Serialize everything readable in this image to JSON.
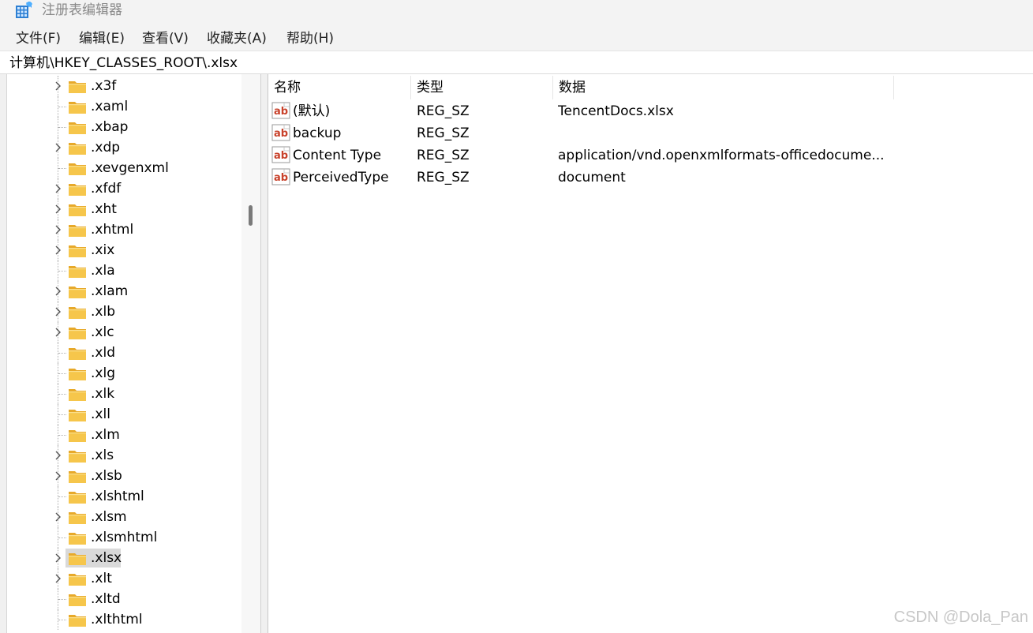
{
  "window": {
    "title": "注册表编辑器",
    "icon": "registry-editor-icon"
  },
  "menu": {
    "items": [
      "文件(F)",
      "编辑(E)",
      "查看(V)",
      "收藏夹(A)",
      "帮助(H)"
    ]
  },
  "address": {
    "path": "计算机\\HKEY_CLASSES_ROOT\\.xlsx"
  },
  "tree": {
    "items": [
      {
        "label": ".x3f",
        "expandable": true
      },
      {
        "label": ".xaml",
        "expandable": false
      },
      {
        "label": ".xbap",
        "expandable": false
      },
      {
        "label": ".xdp",
        "expandable": true
      },
      {
        "label": ".xevgenxml",
        "expandable": false
      },
      {
        "label": ".xfdf",
        "expandable": true
      },
      {
        "label": ".xht",
        "expandable": true
      },
      {
        "label": ".xhtml",
        "expandable": true
      },
      {
        "label": ".xix",
        "expandable": true
      },
      {
        "label": ".xla",
        "expandable": false
      },
      {
        "label": ".xlam",
        "expandable": true
      },
      {
        "label": ".xlb",
        "expandable": true
      },
      {
        "label": ".xlc",
        "expandable": true
      },
      {
        "label": ".xld",
        "expandable": false
      },
      {
        "label": ".xlg",
        "expandable": false
      },
      {
        "label": ".xlk",
        "expandable": false
      },
      {
        "label": ".xll",
        "expandable": false
      },
      {
        "label": ".xlm",
        "expandable": false
      },
      {
        "label": ".xls",
        "expandable": true
      },
      {
        "label": ".xlsb",
        "expandable": true
      },
      {
        "label": ".xlshtml",
        "expandable": false
      },
      {
        "label": ".xlsm",
        "expandable": true
      },
      {
        "label": ".xlsmhtml",
        "expandable": false
      },
      {
        "label": ".xlsx",
        "expandable": true,
        "selected": true
      },
      {
        "label": ".xlt",
        "expandable": true
      },
      {
        "label": ".xltd",
        "expandable": false
      },
      {
        "label": ".xlthtml",
        "expandable": false
      }
    ]
  },
  "values": {
    "columns": {
      "name": "名称",
      "type": "类型",
      "data": "数据"
    },
    "rows": [
      {
        "name": "(默认)",
        "type": "REG_SZ",
        "data": "TencentDocs.xlsx"
      },
      {
        "name": "backup",
        "type": "REG_SZ",
        "data": ""
      },
      {
        "name": "Content Type",
        "type": "REG_SZ",
        "data": "application/vnd.openxmlformats-officedocume..."
      },
      {
        "name": "PerceivedType",
        "type": "REG_SZ",
        "data": "document"
      }
    ]
  },
  "watermark": "CSDN @Dola_Pan",
  "colors": {
    "folder": "#f6c64b",
    "folder_dark": "#e7a92a",
    "selection": "#d9d9d9",
    "ab_red": "#c8412a"
  }
}
